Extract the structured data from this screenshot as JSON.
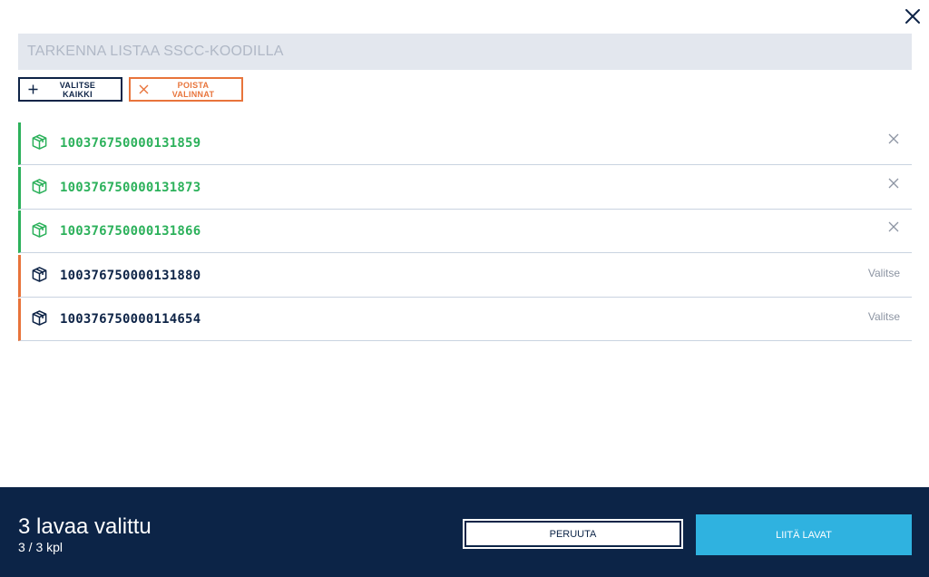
{
  "filter": {
    "placeholder": "TARKENNA LISTAA SSCC-KOODILLA",
    "value": ""
  },
  "actions": {
    "select_all_label": "VALITSE KAIKKI",
    "clear_label": "POISTA VALINNAT"
  },
  "pallets": [
    {
      "code": "100376750000131859",
      "selected": true
    },
    {
      "code": "100376750000131873",
      "selected": true
    },
    {
      "code": "100376750000131866",
      "selected": true
    },
    {
      "code": "100376750000131880",
      "selected": false,
      "action_label": "Valitse"
    },
    {
      "code": "100376750000114654",
      "selected": false,
      "action_label": "Valitse"
    }
  ],
  "footer": {
    "selected_title": "3 lavaa valittu",
    "selected_count": "3 / 3 kpl",
    "cancel_label": "PERUUTA",
    "attach_label": "LIITÄ LAVAT"
  },
  "colors": {
    "selected": "#2cb15b",
    "unselected": "#e8743b",
    "navy": "#0c2447",
    "accent": "#2fb2e0"
  },
  "icons": {
    "close": "close-icon",
    "add": "plus-icon",
    "clear": "x-icon",
    "pallet": "package-icon",
    "remove": "remove-icon"
  }
}
